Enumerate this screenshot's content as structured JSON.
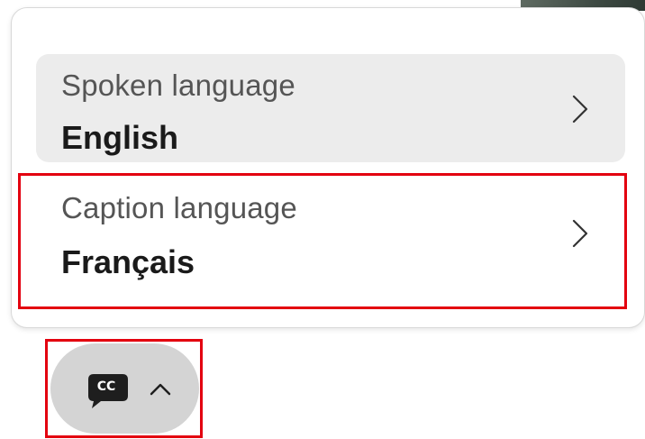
{
  "menu": {
    "spoken": {
      "label": "Spoken language",
      "value": "English"
    },
    "caption": {
      "label": "Caption language",
      "value": "Français"
    }
  },
  "captions_button": {
    "icon_text": "CC"
  },
  "icons": {
    "spoken_chevron": "chevron-right-icon",
    "caption_chevron": "chevron-right-icon",
    "cc": "closed-captions-icon",
    "expand": "chevron-up-icon"
  },
  "colors": {
    "highlight": "#e3000f",
    "selected_row_bg": "#ececec",
    "button_bg": "#d4d4d4"
  }
}
